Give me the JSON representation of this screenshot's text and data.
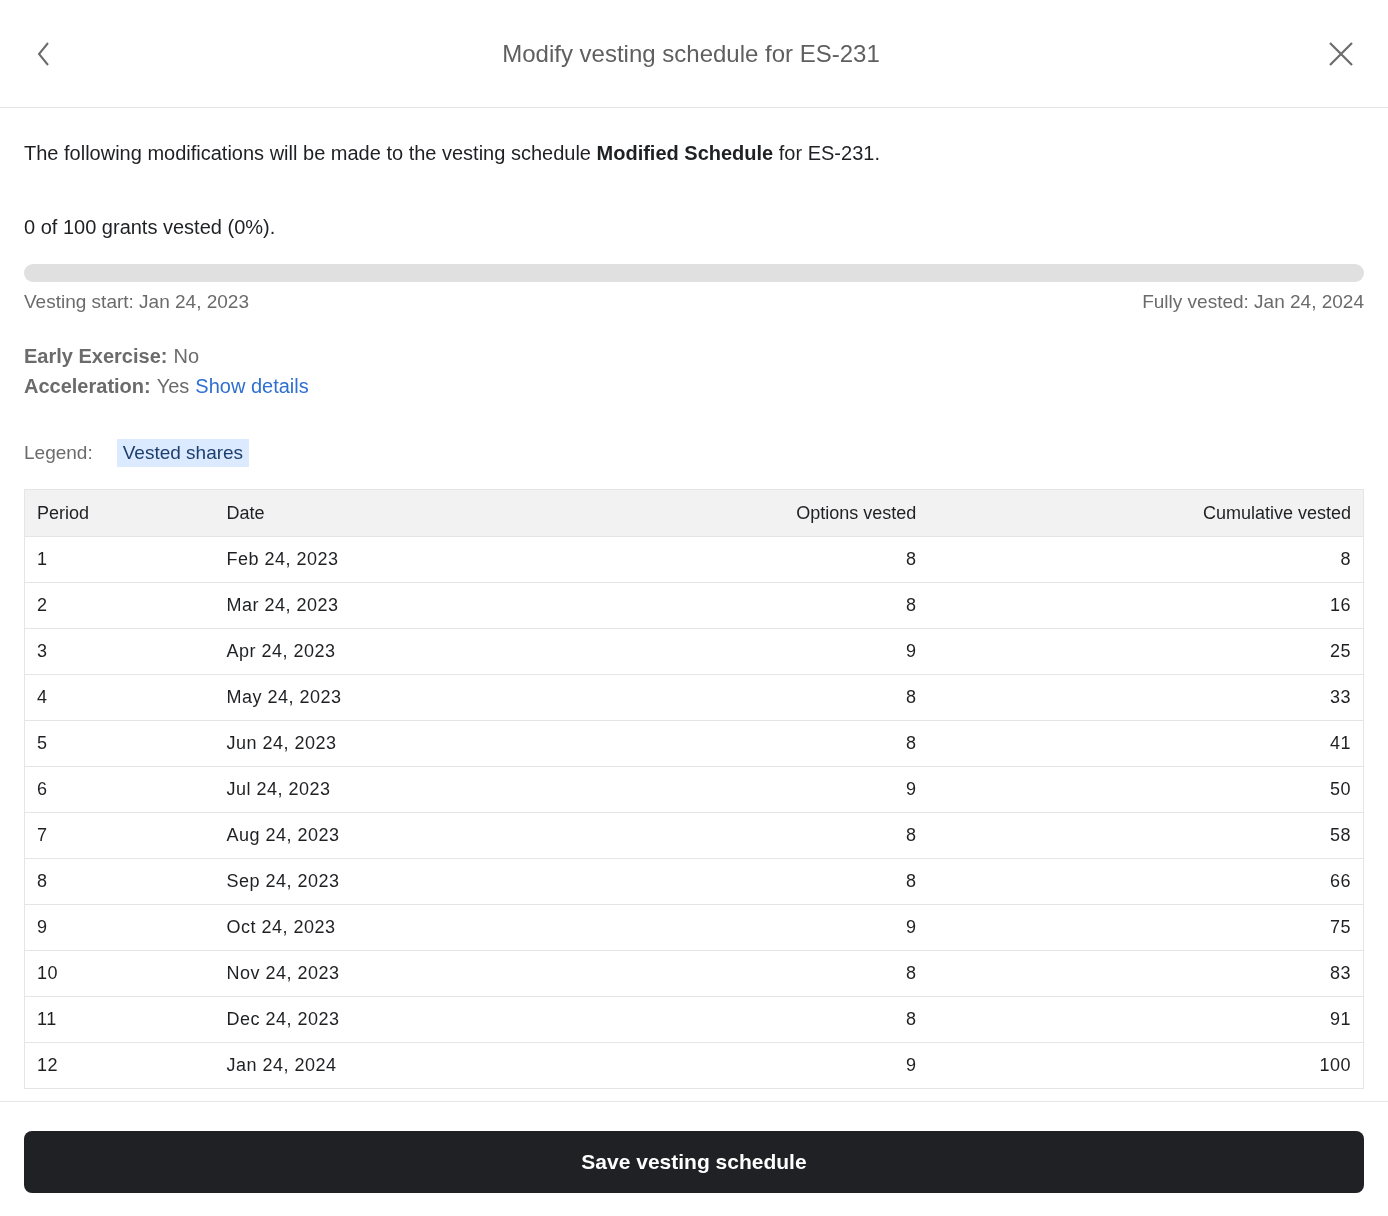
{
  "header": {
    "title": "Modify vesting schedule for ES-231"
  },
  "intro": "The following modifications will be made to the vesting schedule **Modified Schedule** for ES-231.",
  "summary": "0 of 100 grants vested (0%).",
  "progress": {
    "level": 0,
    "start": "Vesting start: Jan 24, 2023",
    "end": "Fully vested: Jan 24, 2024"
  },
  "details": [
    {
      "label": "Early Exercise:",
      "value": "No"
    },
    {
      "label": "Acceleration:",
      "value": "Yes",
      "link": "Show details"
    }
  ],
  "legend": {
    "label": "Legend:",
    "items": [
      {
        "text": "Vested shares",
        "color": "#dbeafe"
      }
    ]
  },
  "table": {
    "columns": [
      "Period",
      "Date",
      "Options vested",
      "Cumulative vested"
    ],
    "rows": [
      [
        "1",
        "Feb 24, 2023",
        "8",
        "8"
      ],
      [
        "2",
        "Mar 24, 2023",
        "8",
        "16"
      ],
      [
        "3",
        "Apr 24, 2023",
        "9",
        "25"
      ],
      [
        "4",
        "May 24, 2023",
        "8",
        "33"
      ],
      [
        "5",
        "Jun 24, 2023",
        "8",
        "41"
      ],
      [
        "6",
        "Jul 24, 2023",
        "9",
        "50"
      ],
      [
        "7",
        "Aug 24, 2023",
        "8",
        "58"
      ],
      [
        "8",
        "Sep 24, 2023",
        "8",
        "66"
      ],
      [
        "9",
        "Oct 24, 2023",
        "9",
        "75"
      ],
      [
        "10",
        "Nov 24, 2023",
        "8",
        "83"
      ],
      [
        "11",
        "Dec 24, 2023",
        "8",
        "91"
      ],
      [
        "12",
        "Jan 24, 2024",
        "9",
        "100"
      ]
    ]
  },
  "save_button": "Save vesting schedule"
}
